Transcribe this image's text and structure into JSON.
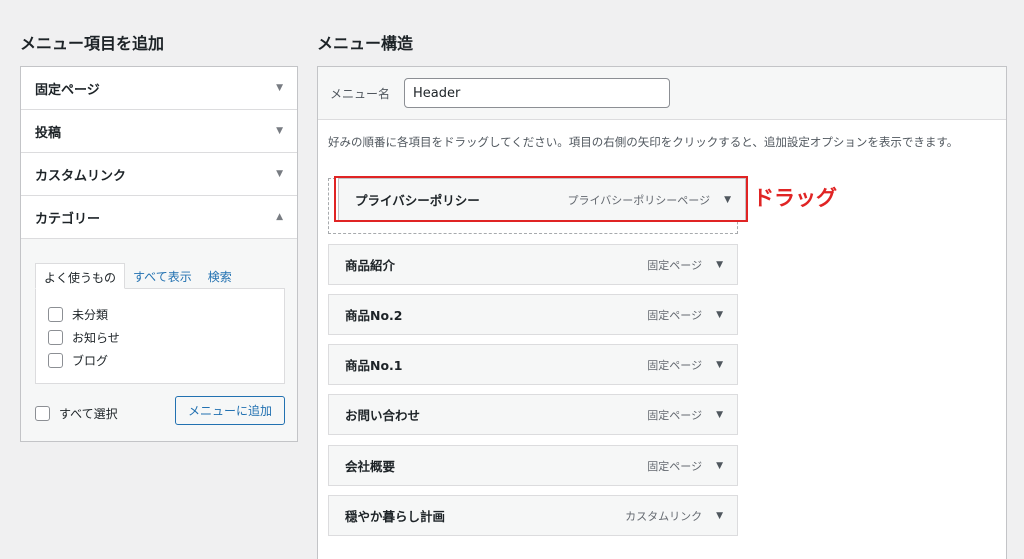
{
  "left_heading": "メニュー項目を追加",
  "right_heading": "メニュー構造",
  "accordion": {
    "sections": [
      {
        "label": "固定ページ",
        "state": "collapsed"
      },
      {
        "label": "投稿",
        "state": "collapsed"
      },
      {
        "label": "カスタムリンク",
        "state": "collapsed"
      },
      {
        "label": "カテゴリー",
        "state": "expanded"
      }
    ],
    "tabs": [
      "よく使うもの",
      "すべて表示",
      "検索"
    ],
    "categories": [
      "未分類",
      "お知らせ",
      "ブログ"
    ],
    "select_all": "すべて選択",
    "add_button": "メニューに追加"
  },
  "menu": {
    "name_label": "メニュー名",
    "name_value": "Header",
    "instructions": "好みの順番に各項目をドラッグしてください。項目の右側の矢印をクリックすると、追加設定オプションを表示できます。",
    "dragging_item": {
      "title": "プライバシーポリシー",
      "type": "プライバシーポリシーページ"
    },
    "items": [
      {
        "title": "商品紹介",
        "type": "固定ページ"
      },
      {
        "title": "商品No.2",
        "type": "固定ページ"
      },
      {
        "title": "商品No.1",
        "type": "固定ページ"
      },
      {
        "title": "お問い合わせ",
        "type": "固定ページ"
      },
      {
        "title": "会社概要",
        "type": "固定ページ"
      },
      {
        "title": "穏やか暮らし計画",
        "type": "カスタムリンク"
      }
    ]
  },
  "annotation": {
    "label": "ドラッグ",
    "color": "#e02424"
  },
  "colors": {
    "accent": "#2271b1",
    "highlight": "#e02424"
  }
}
